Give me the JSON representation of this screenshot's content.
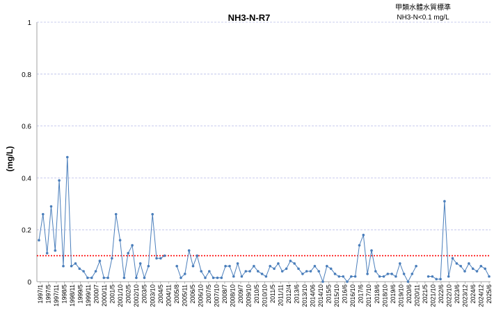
{
  "chart_data": {
    "type": "line",
    "title": "NH3-N-R7",
    "note_line1": "甲類水體水質標準",
    "note_line2": "NH3-N<0.1 mg/L",
    "ylabel": "(mg/L)",
    "xlabel": "",
    "ylim": [
      0,
      1
    ],
    "y_ticks": [
      0,
      0.2,
      0.4,
      0.6,
      0.8,
      1
    ],
    "y_tick_labels": [
      "0",
      "0.2",
      "0.4",
      "0.6",
      "0.8",
      "1"
    ],
    "x_tick_labels": [
      "1997/1",
      "1997/5",
      "1997/11",
      "1998/5",
      "1998/11",
      "1999/5",
      "1999/11",
      "2000/7",
      "2000/11",
      "2001/5",
      "2001/10",
      "2002/5",
      "2002/10",
      "2003/5",
      "2003/10",
      "2004/5",
      "2004/11",
      "2005/8",
      "2005/11",
      "2006/5",
      "2006/10",
      "2007/5",
      "2007/10",
      "2008/7",
      "2008/10",
      "2009/7",
      "2009/10",
      "2010/5",
      "2010/10",
      "2011/5",
      "2011/11",
      "2012/4",
      "2013/6",
      "2013/10",
      "2014/06",
      "2014/10",
      "2015/5",
      "2015/10",
      "2016/6",
      "2016/10",
      "2017/6",
      "2017/10",
      "2018/6",
      "2018/10",
      "2019/6",
      "2019/10",
      "2020/6",
      "2020/11",
      "2021/5",
      "2021/10",
      "2022/6",
      "2022/10",
      "2023/6",
      "2023/12",
      "2024/6",
      "2024/12",
      "2025/6"
    ],
    "grid": true,
    "series": [
      {
        "color": "#4a7ebb",
        "values": [
          0.16,
          0.26,
          0.11,
          0.29,
          0.12,
          0.39,
          0.06,
          0.48,
          0.06,
          0.07,
          0.05,
          0.04,
          0.015,
          0.015,
          0.04,
          0.08,
          0.015,
          0.015,
          0.09,
          0.26,
          0.16,
          0.015,
          0.11,
          0.14,
          0.015,
          0.07,
          0.015,
          0.06,
          0.26,
          0.09,
          0.09,
          0.1,
          null,
          null,
          0.06,
          0.015,
          0.03,
          0.12,
          0.06,
          0.1,
          0.04,
          0.015,
          0.04,
          0.015,
          0.015,
          0.015,
          0.06,
          0.06,
          0.02,
          0.07,
          0.02,
          0.04,
          0.04,
          0.06,
          0.04,
          0.03,
          0.02,
          0.06,
          0.05,
          0.07,
          0.04,
          0.05,
          0.08,
          0.07,
          0.05,
          0.03,
          0.04,
          0.04,
          0.06,
          0.04,
          0.0,
          0.06,
          0.05,
          0.03,
          0.02,
          0.02,
          0.0,
          0.02,
          0.02,
          0.14,
          0.18,
          0.03,
          0.12,
          0.04,
          0.02,
          0.02,
          0.03,
          0.03,
          0.02,
          0.07,
          0.03,
          0.0,
          0.03,
          0.06,
          null,
          null,
          0.02,
          0.02,
          0.01,
          0.01,
          0.31,
          0.02,
          0.09,
          0.07,
          0.06,
          0.04,
          0.07,
          0.05,
          0.04,
          0.06,
          0.05,
          0.02
        ]
      },
      {
        "name": "",
        "color": "#ff0000",
        "dashed": true,
        "values": [
          0.1,
          0.1
        ]
      }
    ]
  }
}
